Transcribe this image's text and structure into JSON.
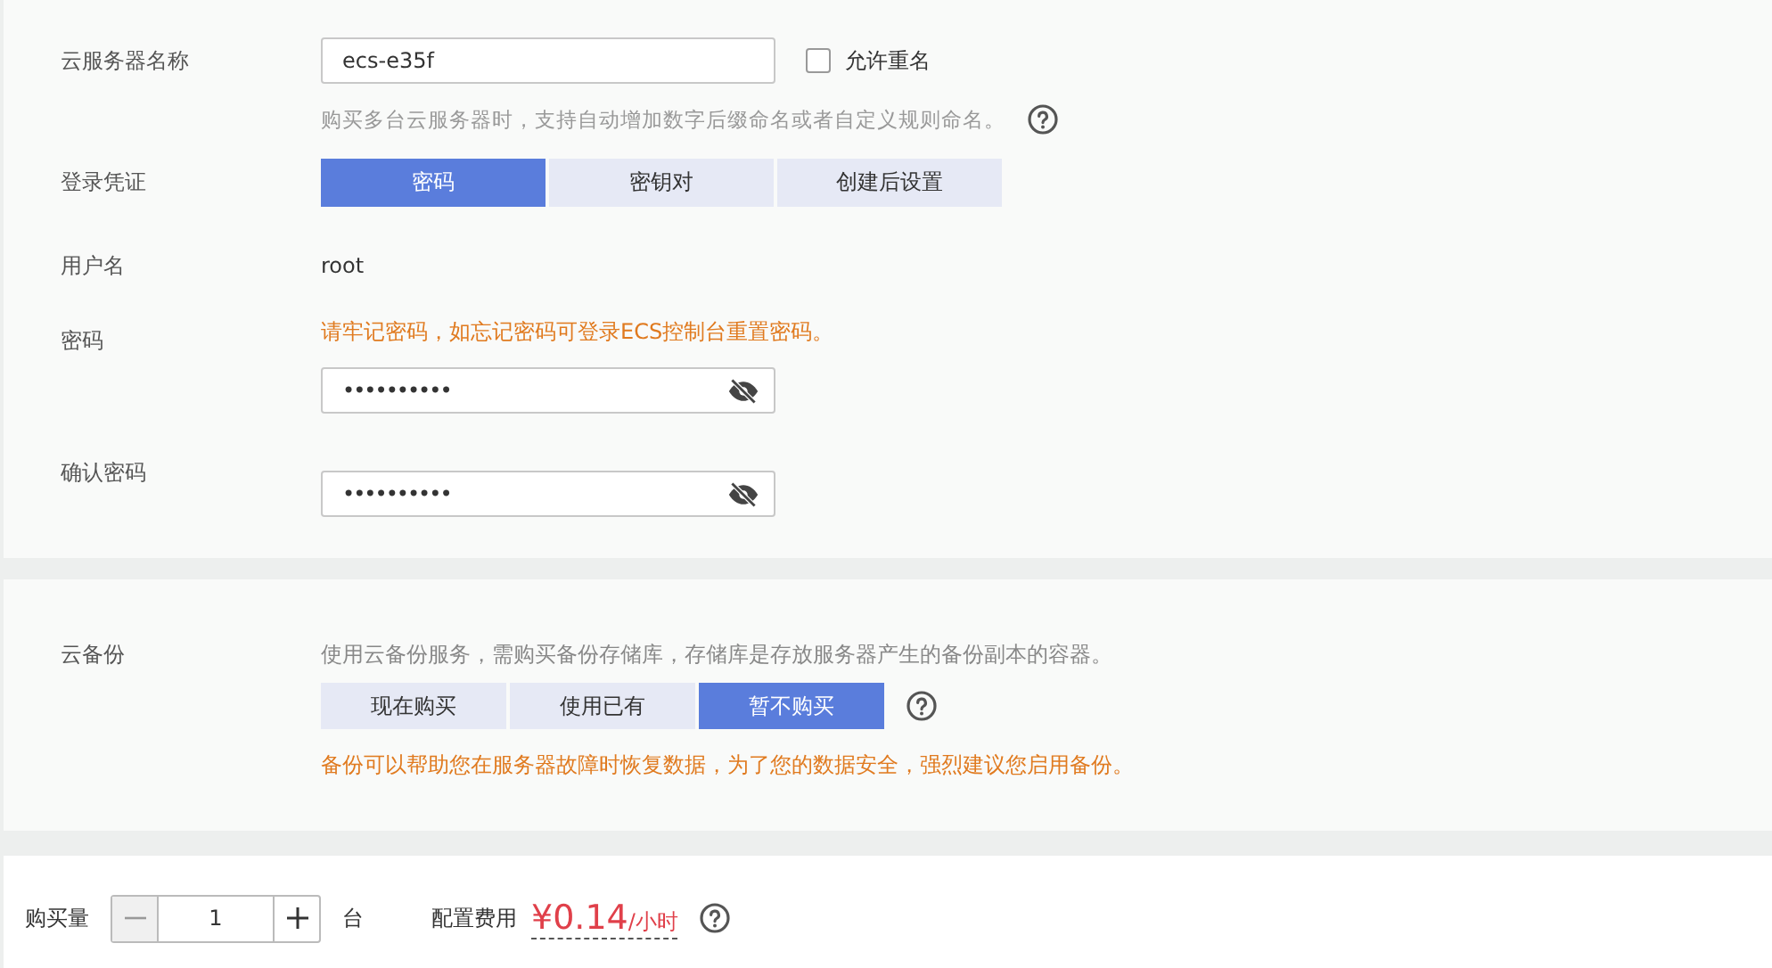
{
  "server_name": {
    "label": "云服务器名称",
    "value": "ecs-e35f",
    "allow_duplicate": {
      "label": "允许重名",
      "checked": false
    },
    "hint": "购买多台云服务器时，支持自动增加数字后缀命名或者自定义规则命名。"
  },
  "login_credential": {
    "label": "登录凭证",
    "options": [
      {
        "label": "密码",
        "selected": true
      },
      {
        "label": "密钥对",
        "selected": false
      },
      {
        "label": "创建后设置",
        "selected": false
      }
    ]
  },
  "username": {
    "label": "用户名",
    "value": "root"
  },
  "password": {
    "label": "密码",
    "warning": "请牢记密码，如忘记密码可登录ECS控制台重置密码。",
    "value": "••••••••••"
  },
  "confirm_password": {
    "label": "确认密码",
    "value": "••••••••••"
  },
  "cloud_backup": {
    "label": "云备份",
    "description": "使用云备份服务，需购买备份存储库，存储库是存放服务器产生的备份副本的容器。",
    "options": [
      {
        "label": "现在购买",
        "selected": false
      },
      {
        "label": "使用已有",
        "selected": false
      },
      {
        "label": "暂不购买",
        "selected": true
      }
    ],
    "warning": "备份可以帮助您在服务器故障时恢复数据，为了您的数据安全，强烈建议您启用备份。"
  },
  "footer": {
    "quantity_label": "购买量",
    "quantity": "1",
    "unit": "台",
    "fee_label": "配置费用",
    "price": "¥0.14",
    "price_unit": "/小时"
  }
}
